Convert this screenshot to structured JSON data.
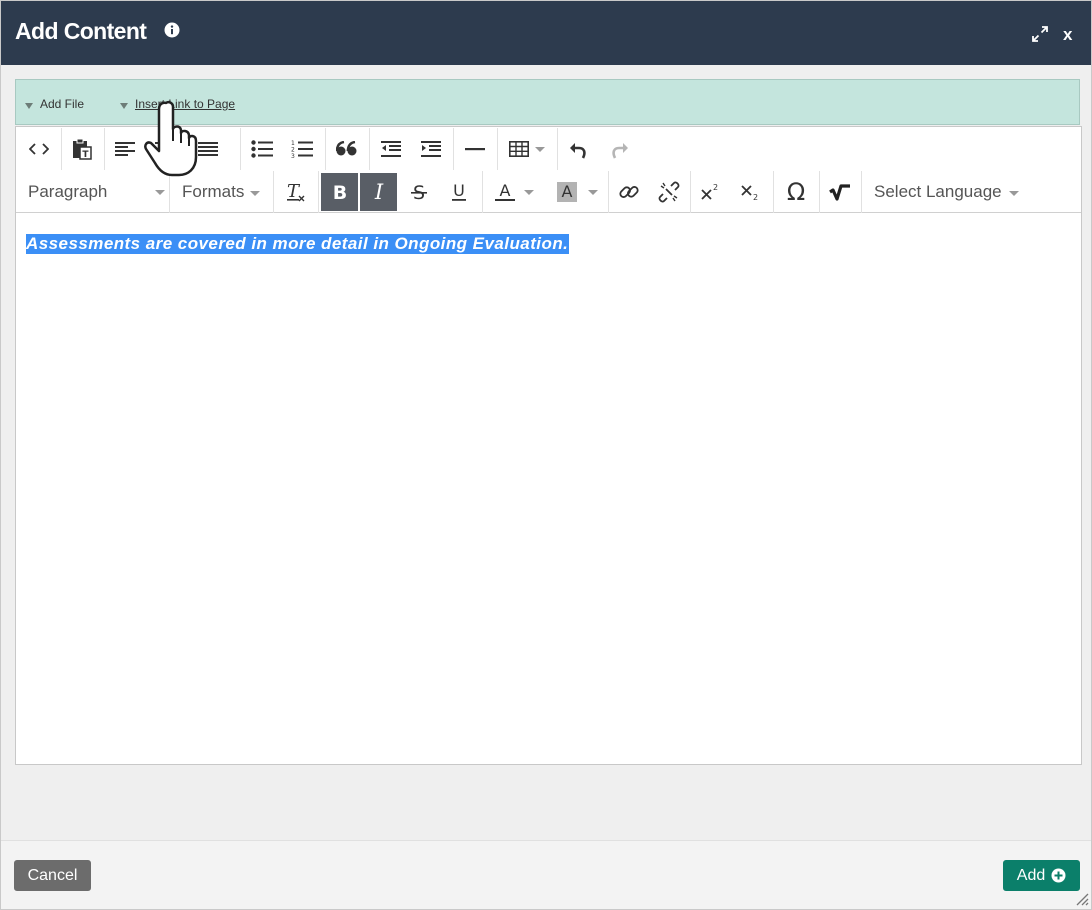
{
  "dialog": {
    "title": "Add Content",
    "icons": {
      "info": "info-icon",
      "expand": "expand-icon",
      "close": "close-icon"
    },
    "close_label": "x",
    "header_color": "#2d3b4e"
  },
  "file_bar": {
    "items": [
      {
        "label": "Add File",
        "icon": "caret-down-icon"
      },
      {
        "label": "Insert Link to Page",
        "icon": "caret-down-icon"
      }
    ],
    "background": "#c4e5dd"
  },
  "toolbar": {
    "row1": [
      "source-code",
      "paste-as-text",
      "align-left",
      "align-center",
      "align-justify",
      "bullet-list",
      "numbered-list",
      "blockquote",
      "outdent",
      "indent",
      "horizontal-rule",
      "table",
      "undo",
      "redo"
    ],
    "row2": {
      "block_format": "Paragraph",
      "formats": "Formats",
      "buttons": [
        "clear-formatting",
        "bold",
        "italic",
        "strikethrough",
        "underline",
        "text-color",
        "background-color",
        "link",
        "unlink",
        "superscript",
        "subscript",
        "special-character",
        "math"
      ],
      "active": [
        "bold",
        "italic"
      ],
      "language": "Select Language"
    }
  },
  "editor": {
    "content": "Assessments are covered in more detail in Ongoing Evaluation.",
    "selection_color": "#3b8ff6"
  },
  "footer": {
    "cancel_label": "Cancel",
    "add_label": "Add",
    "add_color": "#0b7f6a",
    "cancel_color": "#6c6c6c"
  },
  "cursor": "pointer-hand-icon"
}
